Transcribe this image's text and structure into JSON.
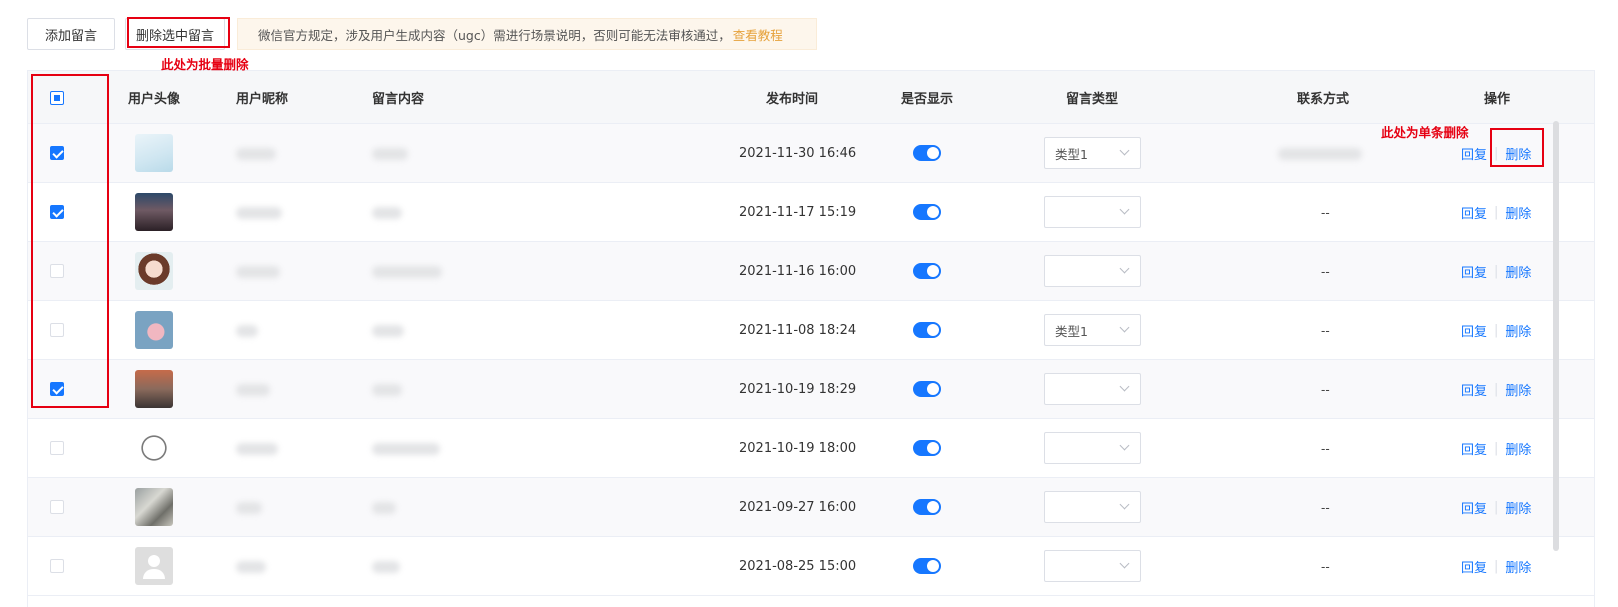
{
  "toolbar": {
    "add_label": "添加留言",
    "delete_selected_label": "删除选中留言",
    "notice_text": "微信官方规定，涉及用户生成内容（ugc）需进行场景说明，否则可能无法审核通过，",
    "notice_link": "查看教程"
  },
  "annotations": {
    "batch_delete": "此处为批量删除",
    "single_delete": "此处为单条删除"
  },
  "table": {
    "headers": {
      "avatar": "用户头像",
      "nickname": "用户昵称",
      "content": "留言内容",
      "time": "发布时间",
      "visible": "是否显示",
      "type": "留言类型",
      "contact": "联系方式",
      "actions": "操作"
    },
    "reply_label": "回复",
    "delete_label": "删除",
    "rows": [
      {
        "checked": true,
        "time": "2021-11-30 16:46",
        "visible": true,
        "type": "类型1",
        "contact": ""
      },
      {
        "checked": true,
        "time": "2021-11-17 15:19",
        "visible": true,
        "type": "",
        "contact": "--"
      },
      {
        "checked": false,
        "time": "2021-11-16 16:00",
        "visible": true,
        "type": "",
        "contact": "--"
      },
      {
        "checked": false,
        "time": "2021-11-08 18:24",
        "visible": true,
        "type": "类型1",
        "contact": "--"
      },
      {
        "checked": true,
        "time": "2021-10-19 18:29",
        "visible": true,
        "type": "",
        "contact": "--"
      },
      {
        "checked": false,
        "time": "2021-10-19 18:00",
        "visible": true,
        "type": "",
        "contact": "--"
      },
      {
        "checked": false,
        "time": "2021-09-27 16:00",
        "visible": true,
        "type": "",
        "contact": "--"
      },
      {
        "checked": false,
        "time": "2021-08-25 15:00",
        "visible": true,
        "type": "",
        "contact": "--"
      }
    ]
  },
  "colors": {
    "accent": "#1677ff",
    "annotation_red": "#e60012",
    "notice_link": "#e6a23c"
  }
}
